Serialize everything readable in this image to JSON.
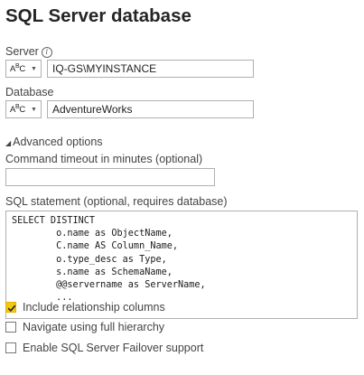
{
  "dialog": {
    "title": "SQL Server database"
  },
  "server": {
    "label": "Server",
    "info_icon": "info-icon",
    "type_glyph": "ABC",
    "value": "IQ-GS\\MYINSTANCE"
  },
  "database": {
    "label": "Database",
    "type_glyph": "ABC",
    "value": "AdventureWorks"
  },
  "advanced": {
    "toggle_label": "Advanced options",
    "expanded": true,
    "timeout_label": "Command timeout in minutes (optional)",
    "timeout_value": "",
    "sql_label": "SQL statement (optional, requires database)",
    "sql_text": "SELECT DISTINCT\n        o.name as ObjectName,\n        C.name AS Column_Name,\n        o.type_desc as Type,\n        s.name as SchemaName,\n        @@servername as ServerName,\n        ..."
  },
  "options": [
    {
      "label": "Include relationship columns",
      "checked": true
    },
    {
      "label": "Navigate using full hierarchy",
      "checked": false
    },
    {
      "label": "Enable SQL Server Failover support",
      "checked": false
    }
  ],
  "colors": {
    "checkbox_checked": "#f2c811",
    "text": "#444444",
    "border": "#b0b0b0"
  }
}
